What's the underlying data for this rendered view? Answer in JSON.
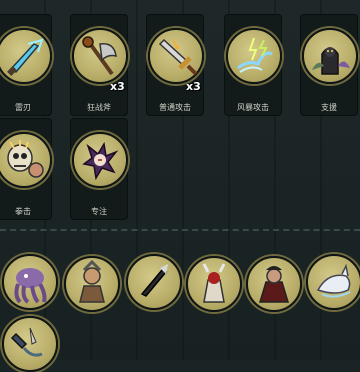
{
  "skills": [
    {
      "label": "雷刃",
      "badge": "",
      "icon": "lightning-blade-icon"
    },
    {
      "label": "狂战斧",
      "badge": "x3",
      "icon": "berserker-axe-icon"
    },
    {
      "label": "普通攻击",
      "badge": "x3",
      "icon": "sword-icon"
    },
    {
      "label": "风暴攻击",
      "badge": "",
      "icon": "storm-claw-icon"
    },
    {
      "label": "支援",
      "badge": "",
      "icon": "support-summon-icon"
    },
    {
      "label": "拳击",
      "badge": "",
      "icon": "skull-punch-icon"
    },
    {
      "label": "专注",
      "badge": "",
      "icon": "focus-spirit-icon"
    }
  ],
  "pool": [
    {
      "icon": "tentacle-monster-icon"
    },
    {
      "icon": "warrior-icon"
    },
    {
      "icon": "throwing-knife-icon"
    },
    {
      "icon": "horned-mage-icon"
    },
    {
      "icon": "vampire-lord-icon"
    },
    {
      "icon": "white-wolf-icon"
    },
    {
      "icon": "dagger-hand-icon"
    }
  ],
  "colors": {
    "background": "#1b2424",
    "card": "#121a1a",
    "medal": "#b8ad68",
    "medal_ring": "#6f6a3e"
  }
}
